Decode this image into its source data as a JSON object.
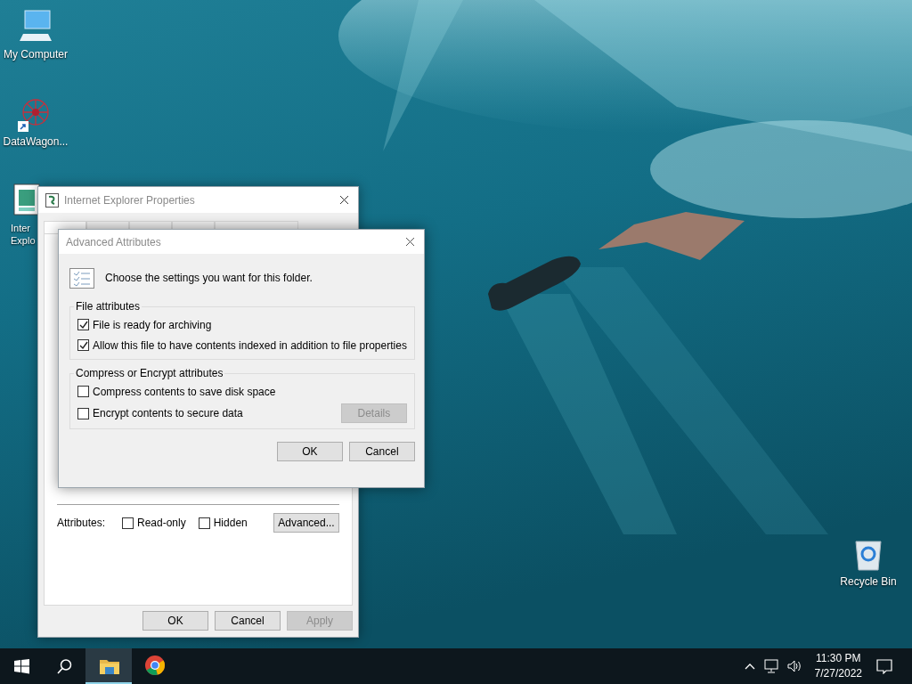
{
  "desktop": {
    "icons": [
      {
        "label": "My Computer",
        "kind": "computer",
        "shortcut": false
      },
      {
        "label": "DataWagon...",
        "kind": "network",
        "shortcut": true
      },
      {
        "label": "Inter Explo",
        "kind": "document",
        "shortcut": false
      },
      {
        "label": "Recycle Bin",
        "kind": "recycle-bin",
        "shortcut": false
      }
    ]
  },
  "properties_window": {
    "title": "Internet Explorer Properties",
    "tabs": [
      {
        "selected": true
      },
      {
        "selected": false
      },
      {
        "selected": false
      },
      {
        "selected": false
      },
      {
        "selected": false
      }
    ],
    "attributes_label": "Attributes:",
    "attributes": [
      {
        "label": "Read-only",
        "checked": false
      },
      {
        "label": "Hidden",
        "checked": false
      }
    ],
    "advanced_button": "Advanced...",
    "buttons": [
      {
        "label": "OK",
        "disabled": false
      },
      {
        "label": "Cancel",
        "disabled": false
      },
      {
        "label": "Apply",
        "disabled": true
      }
    ]
  },
  "advanced_dialog": {
    "title": "Advanced Attributes",
    "intro": "Choose the settings you want for this folder.",
    "groups": [
      {
        "title": "File attributes",
        "options": [
          {
            "label": "File is ready for archiving",
            "checked": true
          },
          {
            "label": "Allow this file to have contents indexed in addition to file properties",
            "checked": true
          }
        ]
      },
      {
        "title": "Compress or Encrypt attributes",
        "options": [
          {
            "label": "Compress contents to save disk space",
            "checked": false
          },
          {
            "label": "Encrypt contents to secure data",
            "checked": false
          }
        ],
        "button": {
          "label": "Details",
          "disabled": true
        }
      }
    ],
    "buttons": [
      {
        "label": "OK",
        "disabled": false
      },
      {
        "label": "Cancel",
        "disabled": false
      }
    ]
  },
  "taskbar": {
    "apps": [
      {
        "kind": "folder",
        "active": true
      },
      {
        "kind": "browser",
        "active": false
      }
    ],
    "time": "11:30 PM",
    "date": "7/27/2022"
  }
}
